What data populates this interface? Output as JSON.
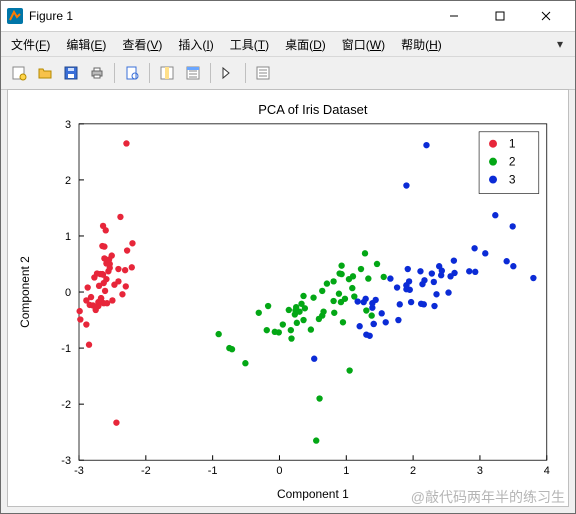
{
  "window": {
    "title": "Figure 1"
  },
  "menu": {
    "items": [
      {
        "label": "文件",
        "accel": "F"
      },
      {
        "label": "编辑",
        "accel": "E"
      },
      {
        "label": "查看",
        "accel": "V"
      },
      {
        "label": "插入",
        "accel": "I"
      },
      {
        "label": "工具",
        "accel": "T"
      },
      {
        "label": "桌面",
        "accel": "D"
      },
      {
        "label": "窗口",
        "accel": "W"
      },
      {
        "label": "帮助",
        "accel": "H"
      }
    ]
  },
  "watermark": "@敲代码两年半的练习生",
  "chart_data": {
    "type": "scatter",
    "title": "PCA of Iris Dataset",
    "xlabel": "Component 1",
    "ylabel": "Component 2",
    "xlim": [
      -3,
      4
    ],
    "ylim": [
      -3,
      3
    ],
    "xticks": [
      -3,
      -2,
      -1,
      0,
      1,
      2,
      3,
      4
    ],
    "yticks": [
      -3,
      -2,
      -1,
      0,
      1,
      2,
      3
    ],
    "legend": {
      "position": "top-right",
      "entries": [
        "1",
        "2",
        "3"
      ]
    },
    "series": [
      {
        "name": "1",
        "color": "#e7263a",
        "points": [
          [
            -2.68,
            0.32
          ],
          [
            -2.71,
            -0.18
          ],
          [
            -2.89,
            -0.15
          ],
          [
            -2.75,
            -0.32
          ],
          [
            -2.73,
            0.33
          ],
          [
            -2.28,
            0.74
          ],
          [
            -2.82,
            -0.09
          ],
          [
            -2.63,
            0.16
          ],
          [
            -2.89,
            -0.58
          ],
          [
            -2.67,
            -0.11
          ],
          [
            -2.51,
            0.65
          ],
          [
            -2.61,
            0.02
          ],
          [
            -2.79,
            -0.24
          ],
          [
            -3.22,
            -0.51
          ],
          [
            -2.64,
            1.18
          ],
          [
            -2.38,
            1.34
          ],
          [
            -2.62,
            0.81
          ],
          [
            -2.65,
            0.32
          ],
          [
            -2.2,
            0.87
          ],
          [
            -2.59,
            0.51
          ],
          [
            -2.31,
            0.39
          ],
          [
            -2.54,
            0.43
          ],
          [
            -3.22,
            0.14
          ],
          [
            -2.3,
            0.1
          ],
          [
            -2.35,
            -0.04
          ],
          [
            -2.5,
            -0.15
          ],
          [
            -2.47,
            0.13
          ],
          [
            -2.56,
            0.37
          ],
          [
            -2.64,
            0.31
          ],
          [
            -2.63,
            -0.2
          ],
          [
            -2.58,
            -0.2
          ],
          [
            -2.41,
            0.41
          ],
          [
            -2.65,
            0.82
          ],
          [
            -2.6,
            1.1
          ],
          [
            -2.67,
            -0.11
          ],
          [
            -2.87,
            0.08
          ],
          [
            -2.62,
            0.6
          ],
          [
            -2.67,
            -0.11
          ],
          [
            -2.98,
            -0.49
          ],
          [
            -2.59,
            0.23
          ],
          [
            -2.77,
            0.26
          ],
          [
            -2.85,
            -0.94
          ],
          [
            -2.99,
            -0.34
          ],
          [
            -2.41,
            0.19
          ],
          [
            -2.21,
            0.44
          ],
          [
            -2.71,
            -0.25
          ],
          [
            -2.54,
            0.5
          ],
          [
            -2.84,
            -0.23
          ],
          [
            -2.55,
            0.58
          ],
          [
            -2.7,
            0.11
          ],
          [
            -2.29,
            2.65
          ],
          [
            -2.44,
            -2.33
          ]
        ]
      },
      {
        "name": "2",
        "color": "#03a715",
        "points": [
          [
            1.28,
            0.69
          ],
          [
            0.93,
            0.32
          ],
          [
            1.46,
            0.5
          ],
          [
            0.18,
            -0.83
          ],
          [
            1.09,
            0.07
          ],
          [
            0.64,
            -0.42
          ],
          [
            1.1,
            0.28
          ],
          [
            -0.75,
            -1.0
          ],
          [
            1.04,
            0.23
          ],
          [
            -0.01,
            -0.72
          ],
          [
            -0.51,
            -1.27
          ],
          [
            0.51,
            -0.1
          ],
          [
            0.26,
            -0.55
          ],
          [
            0.98,
            -0.12
          ],
          [
            -0.17,
            -0.25
          ],
          [
            0.93,
            0.47
          ],
          [
            0.66,
            -0.35
          ],
          [
            0.24,
            -0.33
          ],
          [
            0.95,
            -0.54
          ],
          [
            0.05,
            -0.58
          ],
          [
            1.12,
            -0.08
          ],
          [
            0.36,
            -0.07
          ],
          [
            1.3,
            -0.33
          ],
          [
            0.92,
            -0.18
          ],
          [
            0.71,
            0.15
          ],
          [
            0.9,
            0.33
          ],
          [
            1.33,
            0.24
          ],
          [
            1.56,
            0.27
          ],
          [
            0.81,
            -0.16
          ],
          [
            -0.31,
            -0.37
          ],
          [
            -0.07,
            -0.71
          ],
          [
            -0.19,
            -0.68
          ],
          [
            0.14,
            -0.32
          ],
          [
            1.38,
            -0.42
          ],
          [
            0.59,
            -0.48
          ],
          [
            0.81,
            0.19
          ],
          [
            1.22,
            0.41
          ],
          [
            0.82,
            -0.37
          ],
          [
            0.25,
            -0.27
          ],
          [
            0.17,
            -0.68
          ],
          [
            0.47,
            -0.67
          ],
          [
            0.89,
            -0.03
          ],
          [
            0.23,
            -0.4
          ],
          [
            -0.71,
            -1.02
          ],
          [
            0.36,
            -0.5
          ],
          [
            0.33,
            -0.21
          ],
          [
            0.38,
            -0.29
          ],
          [
            0.64,
            0.02
          ],
          [
            -0.91,
            -0.75
          ],
          [
            0.3,
            -0.35
          ],
          [
            0.55,
            -2.65
          ],
          [
            0.6,
            -1.9
          ],
          [
            1.05,
            -1.4
          ]
        ]
      },
      {
        "name": "3",
        "color": "#0b2bd6",
        "points": [
          [
            2.53,
            -0.01
          ],
          [
            1.41,
            -0.57
          ],
          [
            2.62,
            0.34
          ],
          [
            1.97,
            -0.18
          ],
          [
            2.35,
            -0.04
          ],
          [
            3.4,
            0.55
          ],
          [
            0.52,
            -1.19
          ],
          [
            2.93,
            0.36
          ],
          [
            2.32,
            -0.25
          ],
          [
            2.92,
            0.78
          ],
          [
            1.66,
            0.24
          ],
          [
            1.8,
            -0.22
          ],
          [
            2.17,
            0.21
          ],
          [
            1.35,
            -0.78
          ],
          [
            1.59,
            -0.54
          ],
          [
            1.9,
            0.12
          ],
          [
            1.95,
            0.04
          ],
          [
            3.49,
            1.17
          ],
          [
            3.8,
            0.25
          ],
          [
            1.3,
            -0.76
          ],
          [
            2.43,
            0.38
          ],
          [
            1.2,
            -0.61
          ],
          [
            3.5,
            0.46
          ],
          [
            1.39,
            -0.2
          ],
          [
            2.28,
            0.33
          ],
          [
            2.61,
            0.56
          ],
          [
            1.26,
            -0.18
          ],
          [
            1.29,
            -0.12
          ],
          [
            2.12,
            -0.21
          ],
          [
            2.39,
            0.46
          ],
          [
            2.84,
            0.37
          ],
          [
            3.23,
            1.37
          ],
          [
            2.16,
            -0.22
          ],
          [
            1.44,
            -0.14
          ],
          [
            1.78,
            -0.5
          ],
          [
            3.08,
            0.69
          ],
          [
            2.14,
            0.14
          ],
          [
            1.9,
            0.05
          ],
          [
            1.17,
            -0.17
          ],
          [
            2.11,
            0.37
          ],
          [
            2.31,
            0.18
          ],
          [
            1.92,
            0.41
          ],
          [
            1.41,
            -0.57
          ],
          [
            2.56,
            0.28
          ],
          [
            2.42,
            0.3
          ],
          [
            1.94,
            0.19
          ],
          [
            1.53,
            -0.38
          ],
          [
            1.76,
            0.08
          ],
          [
            1.9,
            0.12
          ],
          [
            1.39,
            -0.28
          ],
          [
            3.31,
            2.62
          ],
          [
            2.2,
            2.62
          ],
          [
            1.9,
            1.9
          ]
        ]
      }
    ]
  }
}
